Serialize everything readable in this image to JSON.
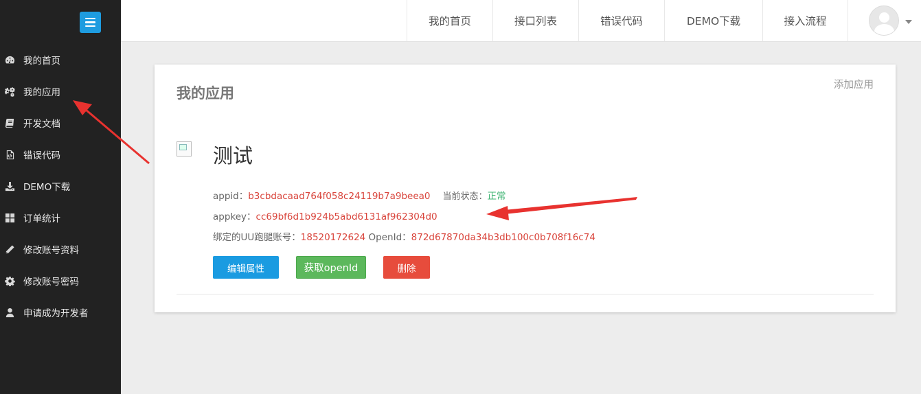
{
  "sidebar": {
    "items": [
      {
        "label": "我的首页",
        "icon": "dashboard-icon"
      },
      {
        "label": "我的应用",
        "icon": "gears-icon"
      },
      {
        "label": "开发文档",
        "icon": "book-icon"
      },
      {
        "label": "错误代码",
        "icon": "code-file-icon"
      },
      {
        "label": "DEMO下载",
        "icon": "download-icon"
      },
      {
        "label": "订单统计",
        "icon": "grid-icon"
      },
      {
        "label": "修改账号资料",
        "icon": "pencil-icon"
      },
      {
        "label": "修改账号密码",
        "icon": "gear-icon"
      },
      {
        "label": "申请成为开发者",
        "icon": "user-icon"
      }
    ]
  },
  "topnav": {
    "items": [
      "我的首页",
      "接口列表",
      "错误代码",
      "DEMO下载",
      "接入流程"
    ]
  },
  "card": {
    "title": "我的应用",
    "add_app": "添加应用",
    "app_name": "测试",
    "appid_label": "appid：",
    "appid_value": "b3cbdacaad764f058c24119b7a9beea0",
    "status_label": "当前状态：",
    "status_value": "正常",
    "appkey_label": "appkey：",
    "appkey_value": "cc69bf6d1b924b5abd6131af962304d0",
    "bound_label": "绑定的UU跑腿账号：",
    "bound_value": "18520172624",
    "openid_label": "OpenId：",
    "openid_value": "872d67870da34b3db100c0b708f16c74",
    "buttons": {
      "edit": "编辑属性",
      "get_openid": "获取openId",
      "delete": "删除"
    }
  },
  "colors": {
    "sidebar_bg": "#222222",
    "accent_blue": "#1a9be1",
    "accent_green": "#5cb85c",
    "accent_red": "#e74c3c",
    "value_red": "#d9453c",
    "status_green": "#3cb371",
    "annotation_arrow": "#e8322f"
  }
}
